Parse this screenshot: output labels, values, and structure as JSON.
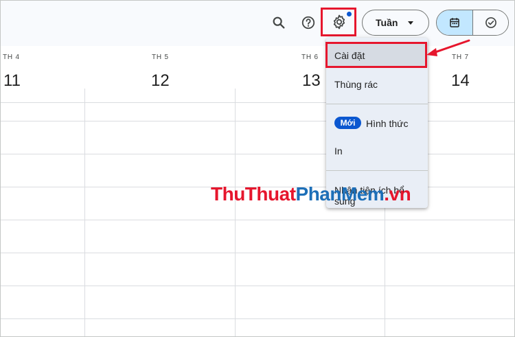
{
  "toolbar": {
    "view_label": "Tuần"
  },
  "days": [
    {
      "name": "TH 4",
      "num": "11"
    },
    {
      "name": "TH 5",
      "num": "12"
    },
    {
      "name": "TH 6",
      "num": "13"
    },
    {
      "name": "TH 7",
      "num": "14"
    }
  ],
  "menu": {
    "settings": "Cài đặt",
    "trash": "Thùng rác",
    "new_badge": "Mới",
    "appearance": "Hình thức",
    "print": "In",
    "addons": "Nhận tiện ích bổ sung"
  },
  "watermark": {
    "part1": "ThuThuat",
    "part2": "PhanMem",
    "part3": ".vn"
  },
  "colors": {
    "highlight_red": "#e6162d",
    "accent_blue": "#0b57d0",
    "selected_view": "#c2e7ff"
  }
}
